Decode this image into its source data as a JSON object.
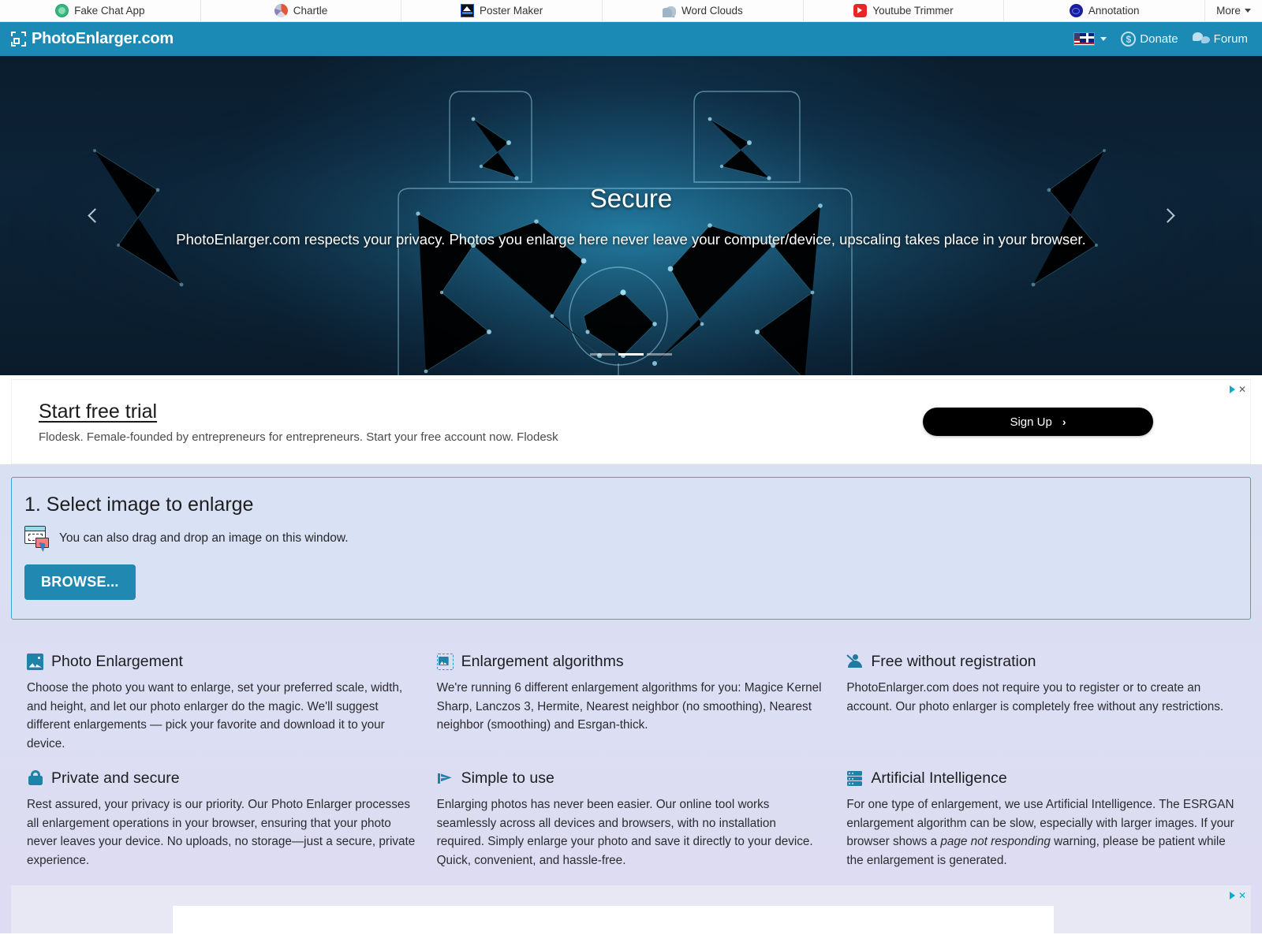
{
  "partner_bar": {
    "items": [
      {
        "label": "Fake Chat App",
        "icon": "fake-chat-app-icon"
      },
      {
        "label": "Chartle",
        "icon": "chartle-icon"
      },
      {
        "label": "Poster Maker",
        "icon": "poster-maker-icon"
      },
      {
        "label": "Word Clouds",
        "icon": "word-clouds-icon"
      },
      {
        "label": "Youtube Trimmer",
        "icon": "youtube-trimmer-icon"
      },
      {
        "label": "Annotation",
        "icon": "annotation-icon"
      }
    ],
    "more_label": "More"
  },
  "header": {
    "brand": "PhotoEnlarger.com",
    "brand_icon": "crop-frame-icon",
    "language_flag": "us-uk-flag-icon",
    "donate_label": "Donate",
    "forum_label": "Forum",
    "accent_color": "#1b8bb5"
  },
  "hero": {
    "title": "Secure",
    "subtitle": "PhotoEnlarger.com respects your privacy. Photos you enlarge here never leave your computer/device, upscaling takes place in your browser.",
    "slide_count": 3,
    "active_slide": 2,
    "prev_icon": "chevron-left-icon",
    "next_icon": "chevron-right-icon"
  },
  "ad_top": {
    "headline": "Start free trial",
    "description": "Flodesk. Female-founded by entrepreneurs for entrepreneurs. Start your free account now. Flodesk",
    "cta_label": "Sign Up",
    "cta_arrow": "›",
    "badge_icon": "adchoices-icon",
    "close_label": "✕"
  },
  "select_panel": {
    "title": "1. Select image to enlarge",
    "dnd_icon": "drag-and-drop-icon",
    "dnd_text": "You can also drag and drop an image on this window.",
    "browse_label": "BROWSE...",
    "browse_color": "#2189b1",
    "border_color": "#39a8cf"
  },
  "features": [
    {
      "icon": "photo-icon",
      "icon_class": "fi-photo",
      "title": "Photo Enlargement",
      "body": "Choose the photo you want to enlarge, set your preferred scale, width, and height, and let our photo enlarger do the magic. We'll suggest different enlargements — pick your favorite and download it to your device."
    },
    {
      "icon": "algorithms-icon",
      "icon_class": "fi-algo",
      "title": "Enlargement algorithms",
      "body": "We're running 6 different enlargement algorithms for you: Magice Kernel Sharp, Lanczos 3, Hermite, Nearest neighbor (no smoothing), Nearest neighbor (smoothing) and Esrgan-thick."
    },
    {
      "icon": "no-registration-icon",
      "icon_class": "fi-free",
      "title": "Free without registration",
      "body": "PhotoEnlarger.com does not require you to register or to create an account. Our photo enlarger is completely free without any restrictions."
    },
    {
      "icon": "lock-icon",
      "icon_class": "fi-lock",
      "title": "Private and secure",
      "body": "Rest assured, your privacy is our priority. Our Photo Enlarger processes all enlargement operations in your browser, ensuring that your photo never leaves your device. No uploads, no storage—just a secure, private experience."
    },
    {
      "icon": "flag-icon",
      "icon_class": "fi-simple",
      "title": "Simple to use",
      "body": "Enlarging photos has never been easier. Our online tool works seamlessly across all devices and browsers, with no installation required. Simply enlarge your photo and save it directly to your device. Quick, convenient, and hassle-free."
    },
    {
      "icon": "server-icon",
      "icon_class": "fi-ai",
      "title": "Artificial Intelligence",
      "body_pre": "For one type of enlargement, we use Artificial Intelligence. The ESRGAN enlargement algorithm can be slow, especially with larger images. If your browser shows a ",
      "body_em": "page not responding",
      "body_post": " warning, please be patient while the enlargement is generated."
    }
  ],
  "ad_bottom": {
    "badge_icon": "adchoices-icon",
    "close_label": "✕"
  }
}
